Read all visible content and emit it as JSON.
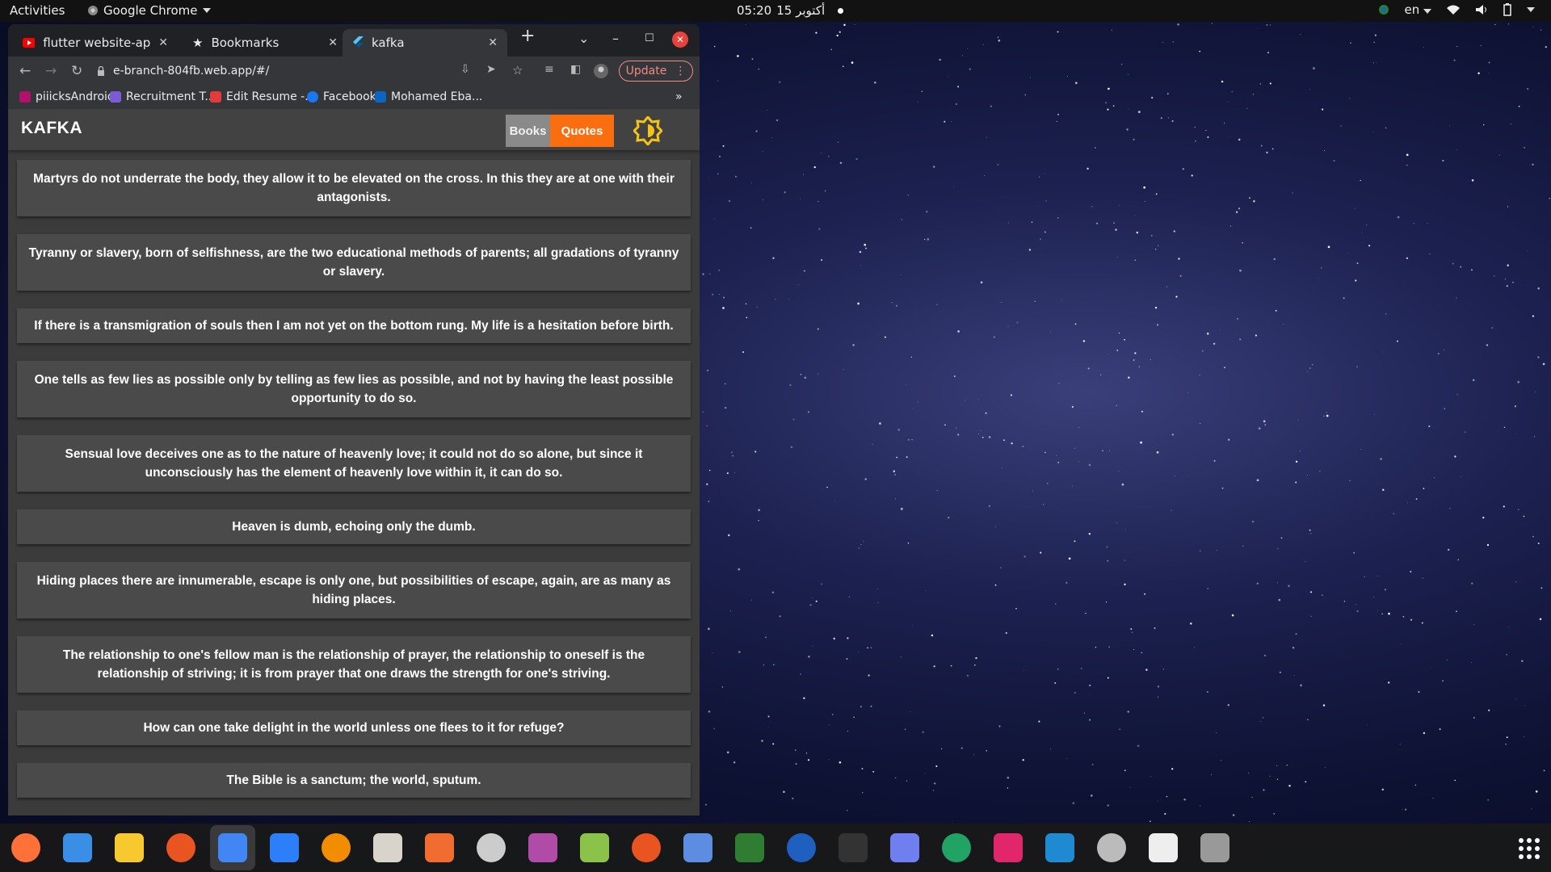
{
  "topbar": {
    "activities": "Activities",
    "app_name": "Google Chrome",
    "clock_time": "05:20",
    "clock_date": "15 أكتوبر",
    "language": "en"
  },
  "browser": {
    "tabs": [
      {
        "title": "flutter website-app",
        "icon": "youtube-icon"
      },
      {
        "title": "Bookmarks",
        "icon": "star-icon"
      },
      {
        "title": "kafka",
        "icon": "flutter-icon"
      }
    ],
    "url": "e-branch-804fb.web.app/#/",
    "update_label": "Update",
    "bookmarks": [
      {
        "label": "piiicksAndroid",
        "color": "#b0126b"
      },
      {
        "label": "Recruitment T...",
        "color": "#7b5cd6"
      },
      {
        "label": "Edit Resume -...",
        "color": "#e23b3b"
      },
      {
        "label": "Facebook",
        "color": "#1877f2"
      },
      {
        "label": "Mohamed Eba...",
        "color": "#0a66c2"
      }
    ],
    "overflow": "»"
  },
  "app": {
    "brand": "KAFKA",
    "books_label": "Books",
    "quotes_label": "Quotes",
    "accent": "#fb6e0f",
    "quotes": [
      "Martyrs do not underrate the body, they allow it to be elevated on the cross. In this they are at one with their antagonists.",
      "Tyranny or slavery, born of selfishness, are the two educational methods of parents; all gradations of tyranny or slavery.",
      "If there is a transmigration of souls then I am not yet on the bottom rung. My life is a hesitation before birth.",
      "One tells as few lies as possible only by telling as few lies as possible, and not by having the least possible opportunity to do so.",
      "Sensual love deceives one as to the nature of heavenly love; it could not do so alone, but since it unconsciously has the element of heavenly love within it, it can do so.",
      "Heaven is dumb, echoing only the dumb.",
      "Hiding places there are innumerable, escape is only one, but possibilities of escape, again, are as many as hiding places.",
      "The relationship to one's fellow man is the relationship of prayer, the relationship to oneself is the relationship of striving; it is from prayer that one draws the strength for one's striving.",
      "How can one take delight in the world unless one flees to it for refuge?",
      "The Bible is a sanctum; the world, sputum."
    ]
  },
  "dock": {
    "apps": [
      "firefox-icon",
      "thunderbird-icon",
      "rhythmbox-icon",
      "software-center-icon",
      "chrome-icon",
      "app-store-icon",
      "vlc-icon",
      "files-icon",
      "pen-icon",
      "document-viewer-icon",
      "video-icon",
      "android-icon",
      "ubuntu-icon",
      "todo-icon",
      "globe-icon",
      "writer-icon",
      "terminal-icon",
      "screenshot-icon",
      "calc-icon",
      "intellij-icon",
      "vscode-icon",
      "updater-icon",
      "device-icon",
      "disk-icon"
    ]
  }
}
